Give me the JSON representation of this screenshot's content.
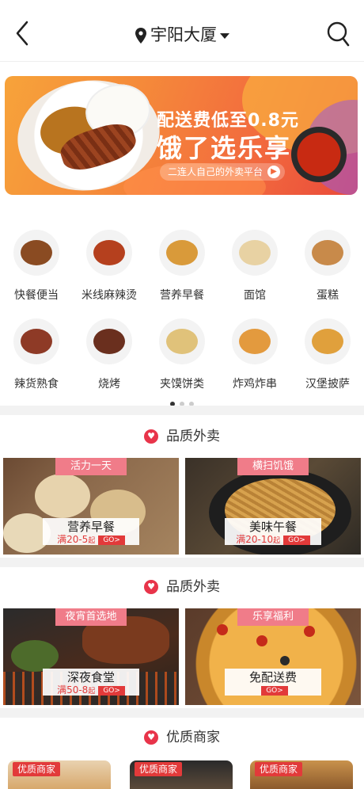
{
  "header": {
    "location": "宇阳大厦",
    "back_icon": "back-arrow-icon",
    "search_icon": "search-icon"
  },
  "banner": {
    "line1": "配送费低至0.8元",
    "line2": "饿了选乐享",
    "pill": "二连人自己的外卖平台"
  },
  "categories": [
    {
      "label": "快餐便当",
      "color": "#8a4b22"
    },
    {
      "label": "米线麻辣烫",
      "color": "#b5401e"
    },
    {
      "label": "营养早餐",
      "color": "#d99a3a"
    },
    {
      "label": "面馆",
      "color": "#e8d2a3"
    },
    {
      "label": "蛋糕",
      "color": "#c88a4a"
    },
    {
      "label": "辣货熟食",
      "color": "#8e3a26"
    },
    {
      "label": "烧烤",
      "color": "#6a2f1e"
    },
    {
      "label": "夹馍饼类",
      "color": "#e0c27a"
    },
    {
      "label": "炸鸡炸串",
      "color": "#e39a3e"
    },
    {
      "label": "汉堡披萨",
      "color": "#e0a03c"
    }
  ],
  "sections": [
    {
      "title": "品质外卖",
      "cards": [
        {
          "tag": "活力一天",
          "name": "营养早餐",
          "sub": "满20-5",
          "sub_suffix": "起",
          "go": "GO>"
        },
        {
          "tag": "横扫饥饿",
          "name": "美味午餐",
          "sub": "满20-10",
          "sub_suffix": "起",
          "go": "GO>"
        }
      ]
    },
    {
      "title": "品质外卖",
      "cards": [
        {
          "tag": "夜宵首选地",
          "name": "深夜食堂",
          "sub": "满50-8",
          "sub_suffix": "起",
          "go": "GO>"
        },
        {
          "tag": "乐享福利",
          "name": "免配送费",
          "sub": "",
          "sub_suffix": "",
          "go": "GO>"
        }
      ]
    }
  ],
  "merchants": {
    "title": "优质商家",
    "tags": [
      "优质商家",
      "优质商家",
      "优质商家"
    ]
  },
  "colors": {
    "accent": "#e8344a",
    "tag_pink": "#f07c89",
    "banner_orange": "#f26a3e"
  }
}
